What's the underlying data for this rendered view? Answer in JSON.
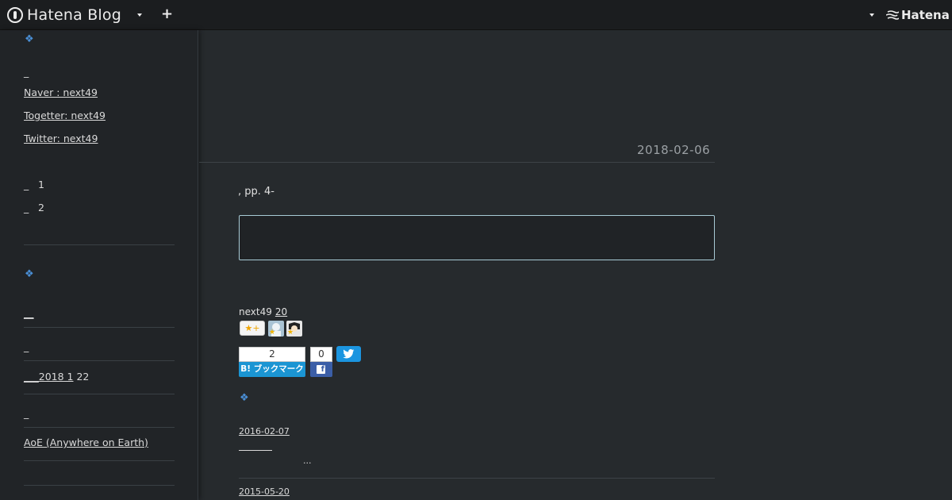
{
  "topbar": {
    "logo_text": "Hatena Blog",
    "plus_icon": "plus-icon",
    "brand_text": "Hatena"
  },
  "sidebar": {
    "dash1": "_",
    "links": [
      "Naver   : next49",
      "Togetter: next49",
      "Twitter: next49"
    ],
    "numbered": [
      {
        "dash": "_",
        "num": "1"
      },
      {
        "dash": "_",
        "num": "2"
      }
    ],
    "list": [
      {
        "text": "__",
        "link": true
      },
      {
        "text": "_",
        "link": false
      },
      {
        "text": "___2018 1",
        "suffix": " 22",
        "link": true
      },
      {
        "text": "_",
        "link": false
      },
      {
        "text": "AoE (Anywhere on Earth)",
        "link": true
      }
    ]
  },
  "article": {
    "date": "2018-02-06",
    "body": ", pp. 4-",
    "author": "next49",
    "author_count": "20",
    "star_add": "★+",
    "bookmark_count": "2",
    "bookmark_label": "B! ブックマーク",
    "facebook_count": "0"
  },
  "related": {
    "items": [
      {
        "date": "2016-02-07",
        "ellipsis": "..."
      },
      {
        "date": "2015-05-20"
      }
    ]
  },
  "colors": {
    "background": "#262a2d",
    "sidebar": "#212427",
    "topbar": "#1b1d1f",
    "accent_diamond": "#4a8fd6",
    "bookmark_blue": "#1b95d3",
    "facebook_blue": "#3b5ea7",
    "twitter_blue": "#1b95e0"
  }
}
